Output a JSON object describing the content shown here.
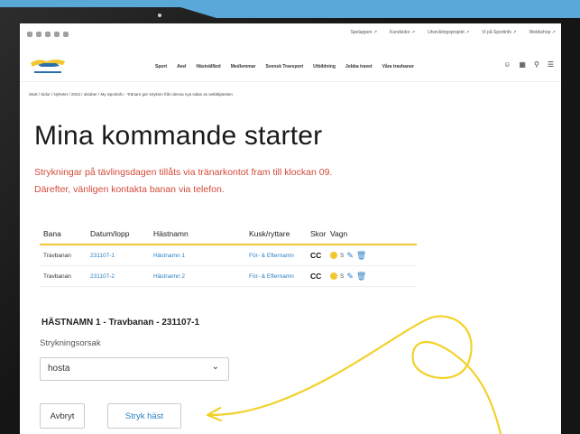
{
  "util_links": [
    "Spelappen ↗",
    "Kundsidor ↗",
    "Utvecklingsprojekt ↗",
    "Vi på Sportinfo ↗",
    "Webbshop ↗"
  ],
  "nav_links": [
    "Sport",
    "Avel",
    "Hästvälfärd",
    "Medlemmar",
    "Svensk Travsport",
    "Utbildning",
    "Jobba travet",
    "Våra travbanor"
  ],
  "breadcrumb": "Start  /  Sidor  /  Nyheter  /  2023  /  oktober  /  My Sportinfo - Tränare gör stryknin från denna nya sidan av webbtjänsten",
  "page_title": "Mina kommande starter",
  "notice_line1": "Strykningar på tävlingsdagen tillåts via tränarkontot fram till klockan 09.",
  "notice_line2": "Därefter, vänligen kontakta banan via telefon.",
  "table": {
    "headers": [
      "Bana",
      "Datum/lopp",
      "Hästnamn",
      "Kusk/ryttare",
      "Skor",
      "Vagn"
    ],
    "rows": [
      {
        "bana": "Travbanan",
        "datum": "231107-1",
        "hast": "Hästnamn 1",
        "kusk": "För- & Efternamn",
        "skor": "CC",
        "vagn": "S"
      },
      {
        "bana": "Travbanan",
        "datum": "231107-2",
        "hast": "Hästnamn 2",
        "kusk": "För- & Efternamn",
        "skor": "CC",
        "vagn": "S"
      }
    ]
  },
  "form": {
    "title": "HÄSTNAMN 1 - Travbanan - 231107-1",
    "select_label": "Strykningsorsak",
    "select_value": "hosta",
    "cancel_label": "Avbryt",
    "confirm_label": "Stryk häst"
  },
  "colors": {
    "accent_red": "#d44a3a",
    "link_blue": "#2b7fc2",
    "yellow": "#f2c62f",
    "background_blue": "#5aa8d8"
  }
}
